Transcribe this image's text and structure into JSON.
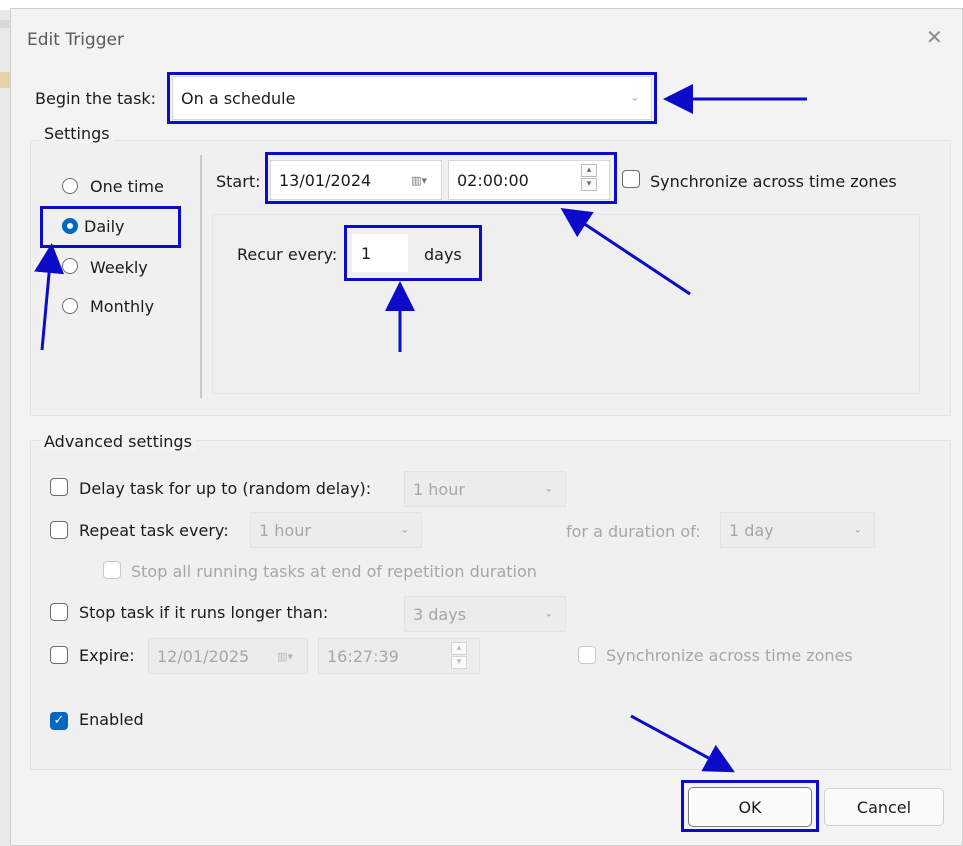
{
  "window": {
    "title": "Edit Trigger",
    "close_glyph": "✕"
  },
  "begin": {
    "label": "Begin the task:",
    "value": "On a schedule"
  },
  "settings": {
    "title": "Settings",
    "radios": [
      {
        "label": "One time",
        "selected": false
      },
      {
        "label": "Daily",
        "selected": true
      },
      {
        "label": "Weekly",
        "selected": false
      },
      {
        "label": "Monthly",
        "selected": false
      }
    ],
    "start_label": "Start:",
    "start_date": "13/01/2024",
    "start_time": "02:00:00",
    "sync_label": "Synchronize across time zones",
    "recur_label": "Recur every:",
    "recur_value": "1",
    "recur_unit": "days"
  },
  "advanced": {
    "title": "Advanced settings",
    "delay_label": "Delay task for up to (random delay):",
    "delay_value": "1 hour",
    "repeat_label": "Repeat task every:",
    "repeat_value": "1 hour",
    "duration_label": "for a duration of:",
    "duration_value": "1 day",
    "stop_all_label": "Stop all running tasks at end of repetition duration",
    "stop_if_label": "Stop task if it runs longer than:",
    "stop_if_value": "3 days",
    "expire_label": "Expire:",
    "expire_date": "12/01/2025",
    "expire_time": "16:27:39",
    "expire_sync_label": "Synchronize across time zones",
    "enabled_label": "Enabled",
    "enabled_checked": true
  },
  "buttons": {
    "ok": "OK",
    "cancel": "Cancel"
  },
  "icons": {
    "calendar": "▥▾",
    "chevron": "⌄",
    "check": "✓",
    "spin_up": "▴",
    "spin_down": "▾"
  },
  "colors": {
    "accent": "#0067c0",
    "annotation": "#0b0bc9"
  }
}
